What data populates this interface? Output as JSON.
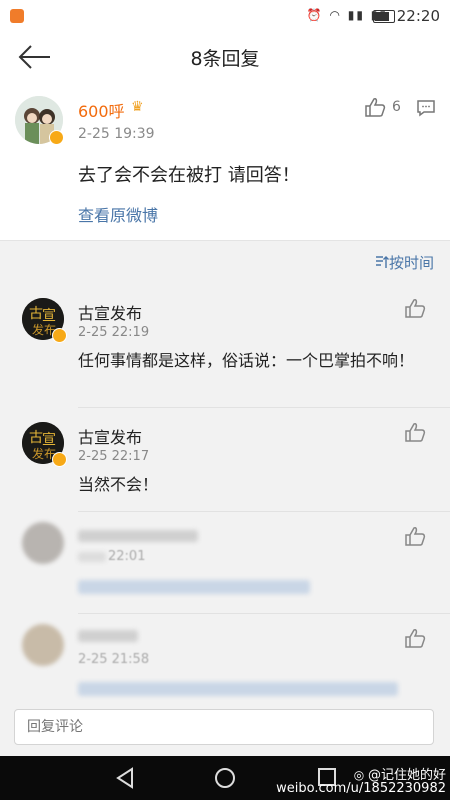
{
  "status": {
    "time": "22:20"
  },
  "nav": {
    "title": "8条回复"
  },
  "post": {
    "author": "600呼",
    "time": "2-25 19:39",
    "like_count": "6",
    "text": "去了会不会在被打 请回答！",
    "view_original": "查看原微博"
  },
  "sort": {
    "label": "按时间"
  },
  "replies": [
    {
      "author": "古宣发布",
      "time": "2-25 22:19",
      "text": "任何事情都是这样，俗话说：一个巴掌拍不响！"
    },
    {
      "author": "古宣发布",
      "time": "2-25 22:17",
      "text": "当然不会！"
    },
    {
      "time": "22:01"
    },
    {
      "time": "2-25 21:58"
    }
  ],
  "input": {
    "placeholder": "回复评论"
  },
  "watermark": {
    "handle": "@记住她的好",
    "url": "weibo.com/u/1852230982"
  },
  "colors": {
    "username_orange": "#f26b0d",
    "link_blue": "#4a76a8",
    "verified_badge": "#f7a917"
  },
  "icons": [
    "back-arrow-icon",
    "like-icon",
    "comment-icon",
    "sort-icon",
    "crown-icon",
    "nav-back-icon",
    "nav-home-icon",
    "nav-recent-icon"
  ]
}
